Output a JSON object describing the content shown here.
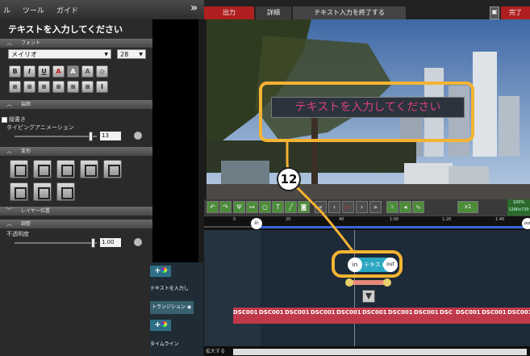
{
  "menu": [
    "ル",
    "ツール",
    "ガイド"
  ],
  "toggle_label": "»",
  "tabs": {
    "output": "出力",
    "detail": "詳細",
    "finish_text": "テキスト入力を終了する",
    "done": "完了"
  },
  "panel_title": "テキストを入力してください",
  "sections": {
    "font": "フォント",
    "decoration": "装飾",
    "transform": "変形",
    "layer": "レイヤー位置",
    "adjust": "調整"
  },
  "font": {
    "family": "メイリオ",
    "size": "28"
  },
  "font_buttons": [
    "B",
    "I",
    "U",
    "A",
    "A",
    "A",
    "◇"
  ],
  "align_buttons": [
    "≡",
    "≡",
    "≡",
    "≡",
    "≡",
    "≡",
    "Ι"
  ],
  "decoration": {
    "vertical_label": "縦書き",
    "typing_label": "タイピングアニメーション",
    "typing_value": "13"
  },
  "adjust": {
    "opacity_label": "不透明度",
    "opacity_value": "1.00"
  },
  "sliders": {
    "typing_fraction": 0.92,
    "opacity_fraction": 0.95
  },
  "preview": {
    "text": "テキストを入力してください"
  },
  "callout_number": "12",
  "toolbar": {
    "speed": "x1",
    "zoom": "100%",
    "resolution": "1280x720"
  },
  "ruler_ticks": [
    "0",
    "20",
    "40",
    "1:00",
    "1:20",
    "1:40"
  ],
  "in_marker": "in",
  "out_marker": "out",
  "clip": {
    "in": "in",
    "text": "テキスト",
    "out": "out"
  },
  "clips": [
    "DSC001",
    "DSC001",
    "DSC001",
    "DSC001",
    "DSC001",
    "DSC001",
    "DSC001",
    "DSC001",
    "DSC",
    "DSC001",
    "DSC001",
    "DSC001"
  ],
  "tracks": {
    "text_track": "テキストを入力し",
    "transition": "トランジション",
    "timeline": "タイムライン"
  },
  "bottom_label": "拡大する",
  "colors": {
    "accent_orange": "#f5b332",
    "preview_text": "#d9407a",
    "header_red": "#b01f1f",
    "clip_bar": "#c0394a"
  }
}
